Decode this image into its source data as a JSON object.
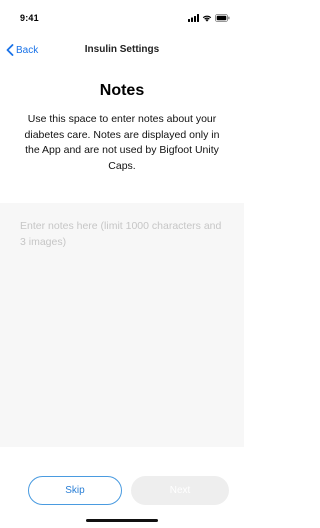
{
  "status_bar": {
    "time": "9:41",
    "icons": [
      "signal-icon",
      "wifi-icon",
      "battery-icon"
    ]
  },
  "nav": {
    "back_label": "Back",
    "title": "Insulin Settings"
  },
  "page": {
    "heading": "Notes",
    "description": "Use this space to enter notes about your diabetes care. Notes are displayed only in the App and are not used by Bigfoot Unity Caps."
  },
  "notes": {
    "value": "",
    "placeholder": "Enter notes here (limit 1000 characters and 3 images)"
  },
  "actions": {
    "skip_label": "Skip",
    "next_label": "Next"
  },
  "colors": {
    "accent": "#1a73e8",
    "notes_background": "#f7f7f7",
    "disabled_button": "#eeeeee"
  }
}
